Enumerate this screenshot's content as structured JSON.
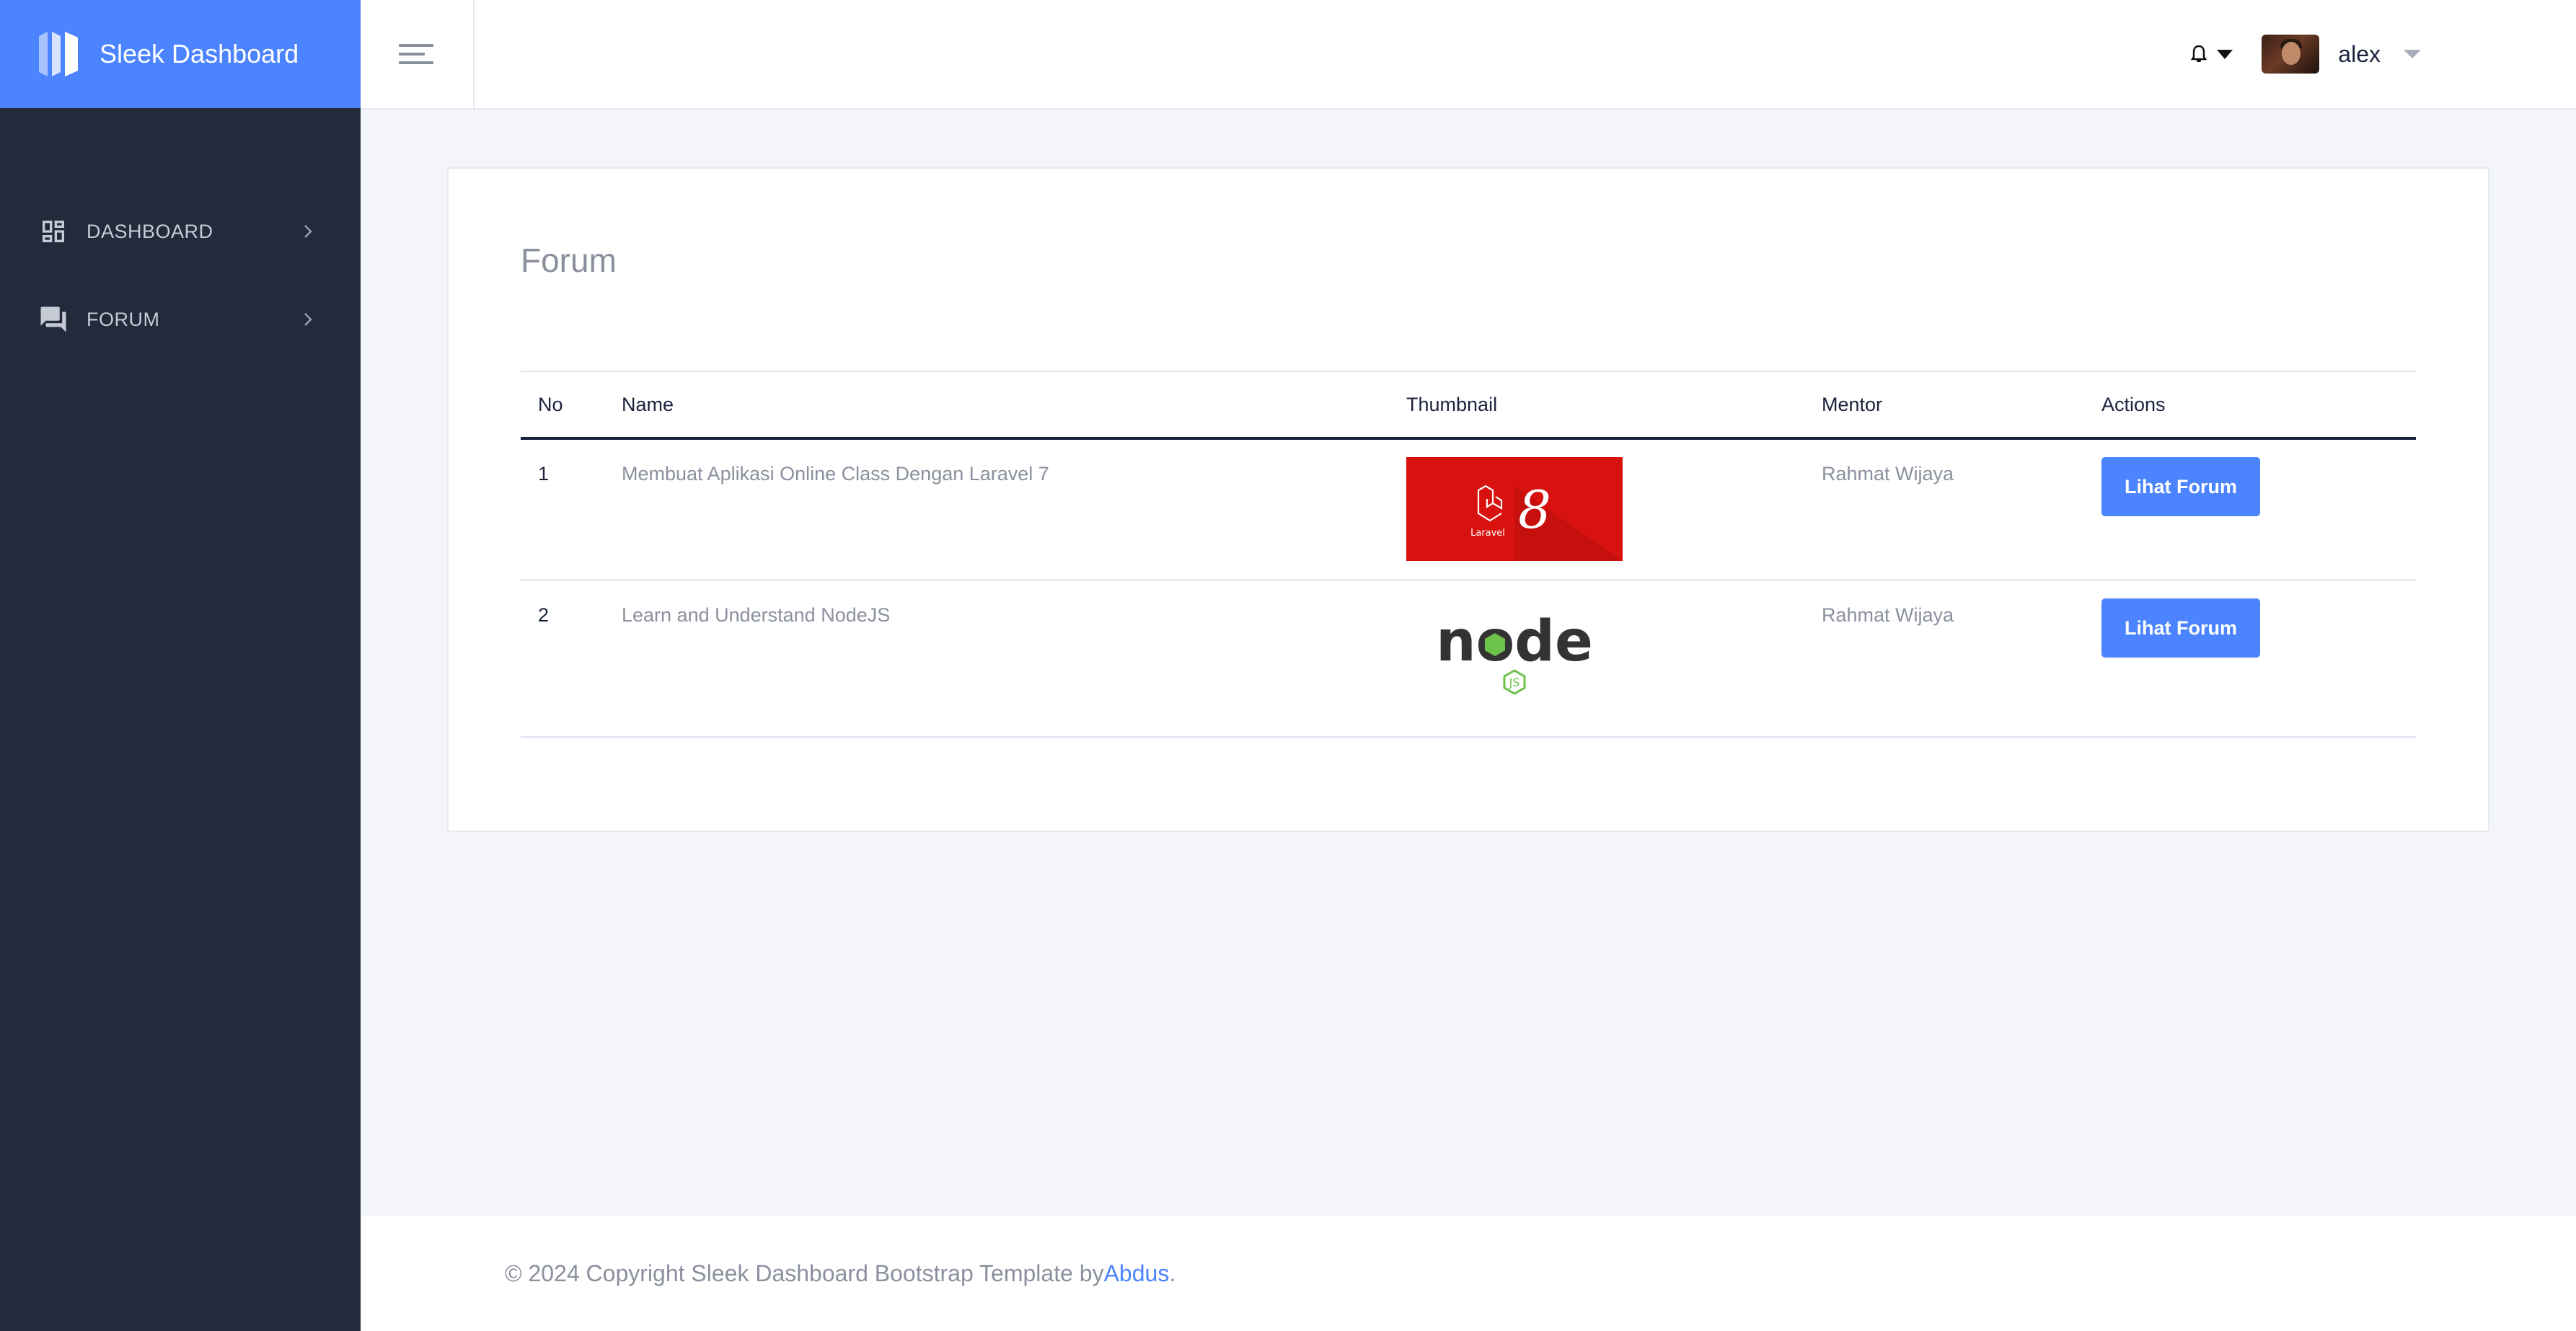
{
  "brand": {
    "name": "Sleek Dashboard",
    "icon": "sleek-logo-icon",
    "color": "#4c84ff"
  },
  "sidebar": {
    "items": [
      {
        "label": "DASHBOARD",
        "icon": "dashboard-icon"
      },
      {
        "label": "FORUM",
        "icon": "forum-icon"
      }
    ]
  },
  "header": {
    "toggle_icon": "menu-toggle-icon",
    "notification_icon": "bell-icon",
    "user_name": "alex"
  },
  "page": {
    "title": "Forum"
  },
  "table": {
    "columns": [
      "No",
      "Name",
      "Thumbnail",
      "Mentor",
      "Actions"
    ],
    "rows": [
      {
        "no": "1",
        "name": "Membuat Aplikasi Online Class Dengan Laravel 7",
        "thumbnail": "laravel-8-thumbnail",
        "mentor": "Rahmat Wijaya",
        "action": "Lihat Forum"
      },
      {
        "no": "2",
        "name": "Learn and Understand NodeJS",
        "thumbnail": "nodejs-thumbnail",
        "mentor": "Rahmat Wijaya",
        "action": "Lihat Forum"
      }
    ]
  },
  "thumbnails": {
    "laravel_text": "Laravel",
    "laravel_version": "8",
    "node_text": "node",
    "node_js": "JS"
  },
  "footer": {
    "text": "© 2024 Copyright Sleek Dashboard Bootstrap Template by ",
    "author": "Abdus",
    "end": "."
  }
}
